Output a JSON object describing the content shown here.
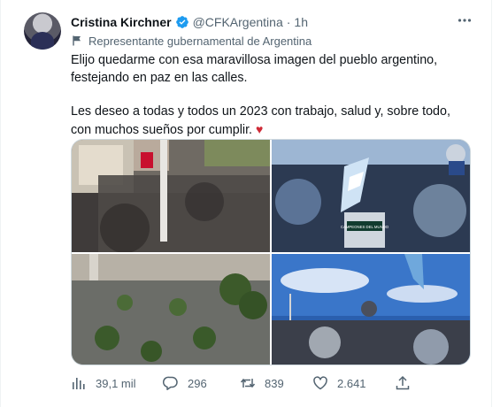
{
  "tweet": {
    "author_name": "Cristina Kirchner",
    "handle": "@CFKArgentina",
    "separator": "·",
    "time": "1h",
    "label": "Representante gubernamental de Argentina",
    "text_line1": "Elijo quedarme con esa maravillosa imagen del pueblo argentino, festejando en paz en las calles.",
    "text_line2": "Les deseo a todas y todos un 2023 con trabajo, salud y, sobre todo, con muchos sueños por cumplir.",
    "heart": "♥"
  },
  "media": {
    "bus_sign": "CAMPEONES DEL MUNDO"
  },
  "metrics": {
    "views": "39,1 mil",
    "replies": "296",
    "retweets": "839",
    "likes": "2.641"
  },
  "icons": {
    "verified": "verified-badge-icon",
    "more": "more-icon",
    "label": "flag-icon",
    "views": "views-icon",
    "reply": "reply-icon",
    "retweet": "retweet-icon",
    "like": "like-icon",
    "share": "share-icon"
  },
  "colors": {
    "text": "#0f1419",
    "secondary": "#536471",
    "verified": "#1d9bf0",
    "heart": "#cf2a36",
    "border": "#cfd9de"
  }
}
